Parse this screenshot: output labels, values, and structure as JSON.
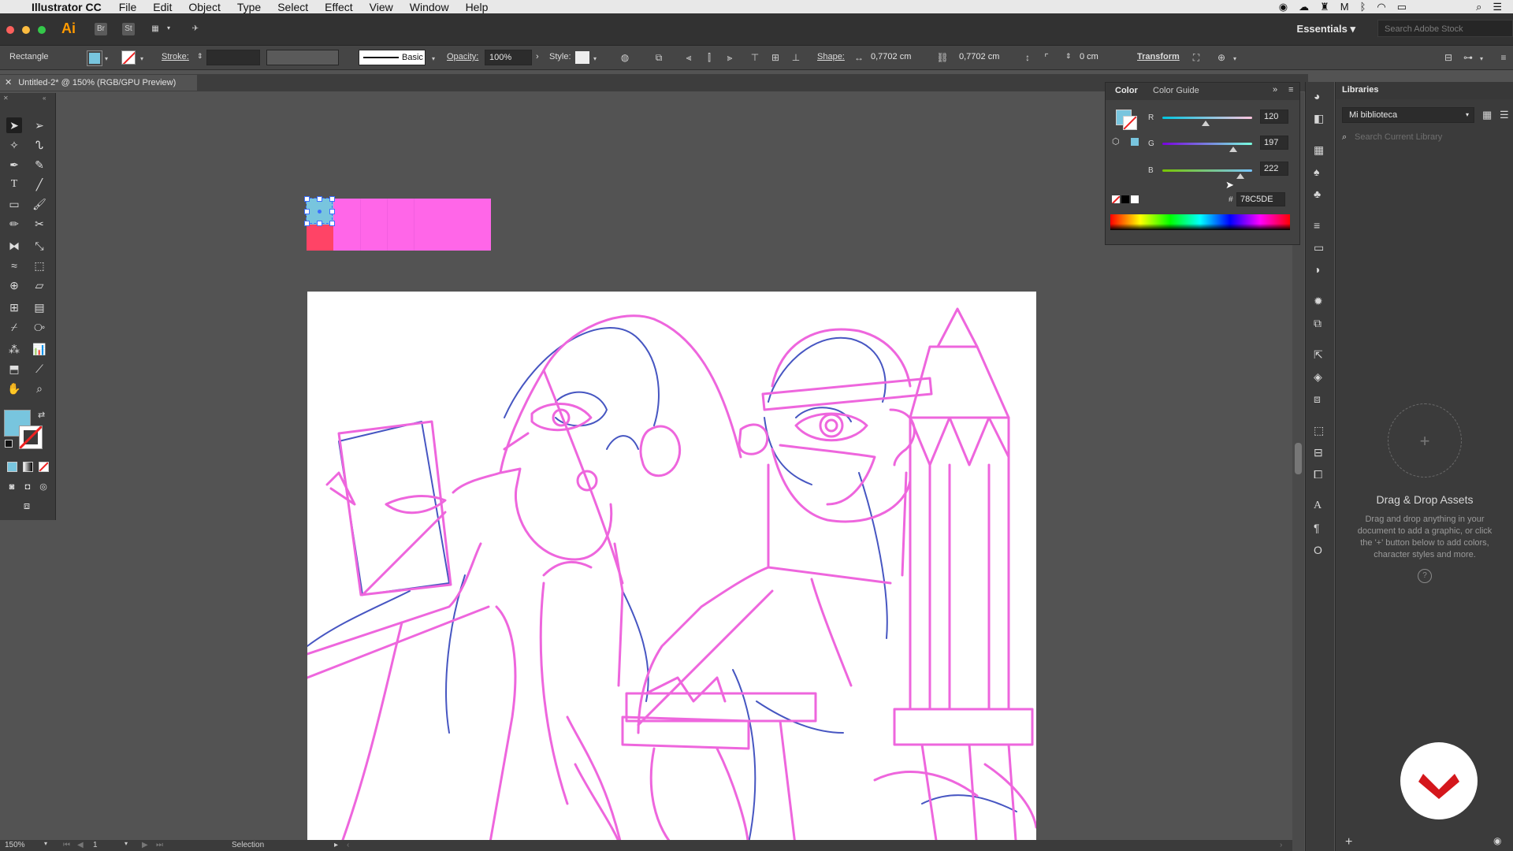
{
  "menubar": {
    "app_name": "Illustrator CC",
    "items": [
      "File",
      "Edit",
      "Object",
      "Type",
      "Select",
      "Effect",
      "View",
      "Window",
      "Help"
    ]
  },
  "appbar": {
    "logo": "Ai",
    "br": "Br",
    "st": "St",
    "workspace": "Essentials",
    "stock_placeholder": "Search Adobe Stock"
  },
  "control": {
    "object_type": "Rectangle",
    "stroke_label": "Stroke:",
    "brush_label": "Basic",
    "opacity_label": "Opacity:",
    "opacity_value": "100%",
    "style_label": "Style:",
    "shape_label": "Shape:",
    "width_value": "0,7702 cm",
    "height_value": "0,7702 cm",
    "corner_value": "0 cm",
    "transform_label": "Transform",
    "fill_color": "#78C5DE"
  },
  "document": {
    "tab_title": "Untitled-2* @ 150% (RGB/GPU Preview)"
  },
  "color_panel": {
    "tab_color": "Color",
    "tab_guide": "Color Guide",
    "r_label": "R",
    "r_value": "120",
    "g_label": "G",
    "g_value": "197",
    "b_label": "B",
    "b_value": "222",
    "hex_label": "#",
    "hex_value": "78C5DE"
  },
  "libraries": {
    "title": "Libraries",
    "library_name": "Mi biblioteca",
    "search_placeholder": "Search Current Library",
    "drop_title": "Drag & Drop Assets",
    "drop_text": "Drag and drop anything in your document to add a graphic, or click the '+' button below to add colors, character styles and more."
  },
  "status": {
    "zoom": "150%",
    "page": "1",
    "tool": "Selection"
  },
  "swatches": {
    "pink": "#FF66E8",
    "red": "#FF4466",
    "blue": "#78C5DE",
    "stroke_pink": "#EE66DD",
    "stroke_blue": "#3344BB"
  }
}
